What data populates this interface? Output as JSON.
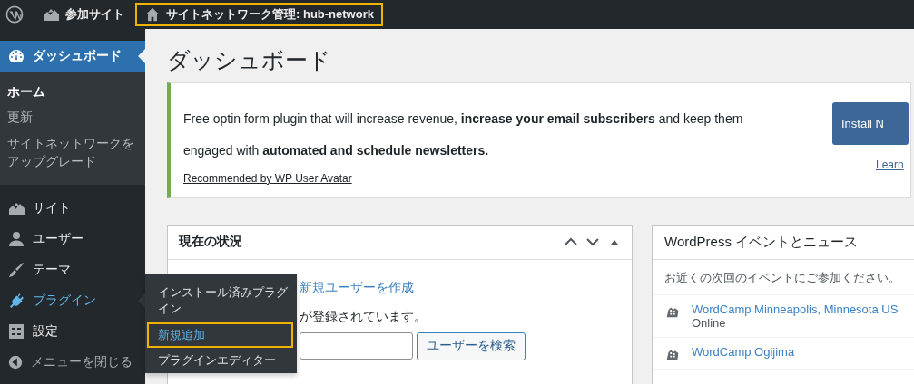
{
  "admin_bar": {
    "sites_label": "参加サイト",
    "network_admin": {
      "label": "サイトネットワーク管理: hub-network",
      "highlighted": true
    }
  },
  "sidebar": {
    "items": [
      {
        "label": "ダッシュボード",
        "selected": true,
        "hovered": false,
        "children": [
          {
            "label": "ホーム",
            "selected": true
          },
          {
            "label": "更新",
            "selected": false
          },
          {
            "label": "サイトネットワークをアップグレード",
            "selected": false
          }
        ]
      },
      {
        "label": "サイト",
        "selected": false,
        "hovered": false
      },
      {
        "label": "ユーザー",
        "selected": false,
        "hovered": false
      },
      {
        "label": "テーマ",
        "selected": false,
        "hovered": false
      },
      {
        "label": "プラグイン",
        "selected": false,
        "hovered": true,
        "children": [
          {
            "label": "インストール済みプラグイン",
            "highlighted": false
          },
          {
            "label": "新規追加",
            "highlighted": true
          },
          {
            "label": "プラグインエディター",
            "highlighted": false
          }
        ]
      },
      {
        "label": "設定",
        "selected": false,
        "hovered": false
      }
    ],
    "collapse_label": "メニューを閉じる"
  },
  "page_title": "ダッシュボード",
  "notice": {
    "text": "Free optin form plugin that will increase revenue, **increase your email subscribers** and keep them engaged with **automated and schedule newsletters.**",
    "recommended": "Recommended by WP User Avatar",
    "button": "Install N",
    "learn_link": "Learn"
  },
  "status_widget": {
    "title": "現在の状況",
    "link": "新規ユーザーを作成",
    "text": "が登録されています。",
    "search_button": "ユーザーを検索"
  },
  "events_widget": {
    "title": "WordPress イベントとニュース",
    "intro": "お近くの次回のイベントにご参加ください。",
    "events": [
      {
        "name": "WordCamp Minneapolis, Minnesota US",
        "location": "Online"
      },
      {
        "name": "WordCamp Ogijima"
      }
    ]
  }
}
